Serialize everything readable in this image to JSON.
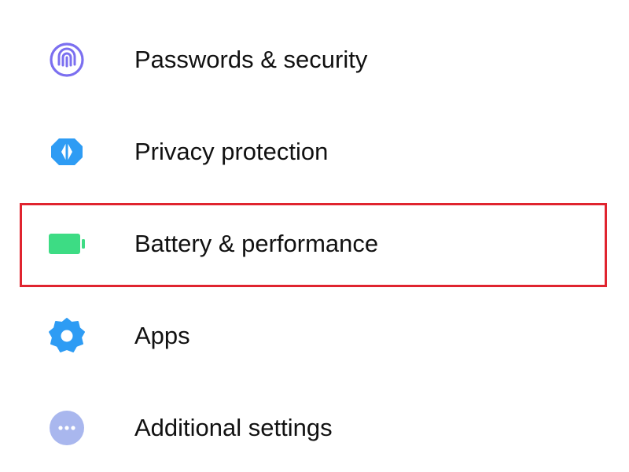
{
  "settings": {
    "items": [
      {
        "label": "Passwords & security",
        "icon": "fingerprint-icon",
        "color": "#7b6ff0"
      },
      {
        "label": "Privacy protection",
        "icon": "privacy-shield-icon",
        "color": "#2e9cf4"
      },
      {
        "label": "Battery & performance",
        "icon": "battery-icon",
        "color": "#3ddc84"
      },
      {
        "label": "Apps",
        "icon": "gear-icon",
        "color": "#2e9cf4"
      },
      {
        "label": "Additional settings",
        "icon": "more-dots-icon",
        "color": "#a9b7ee"
      }
    ]
  },
  "highlight": {
    "target": "Battery & performance",
    "color": "#e0242f"
  }
}
